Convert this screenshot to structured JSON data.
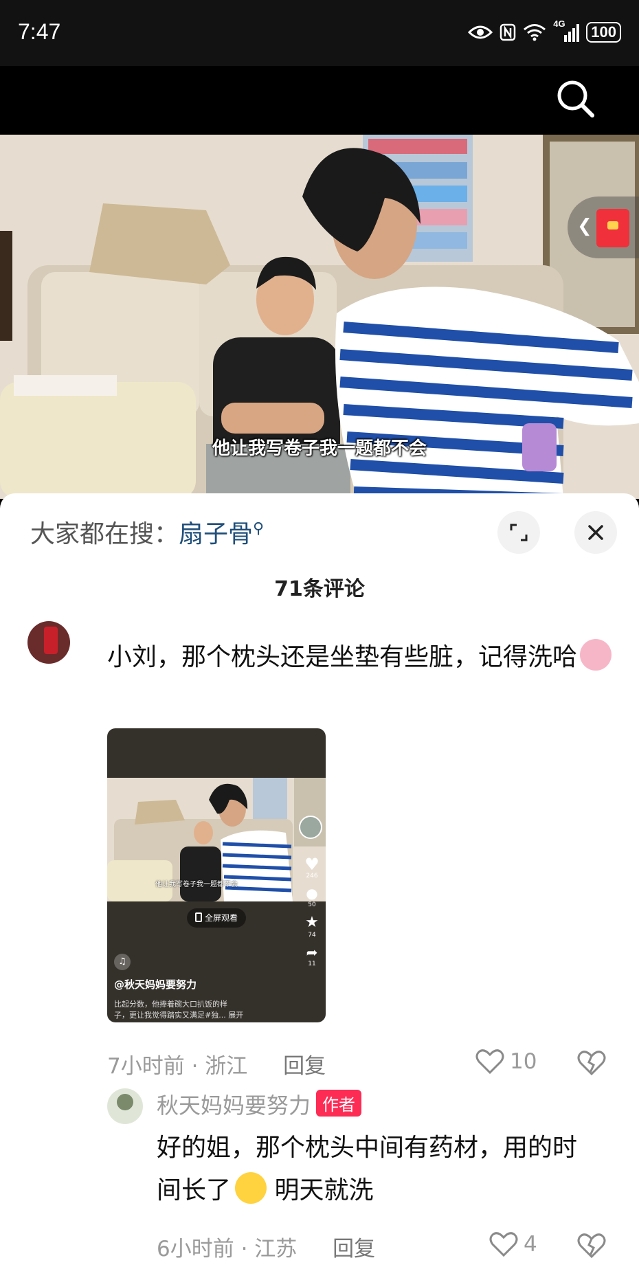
{
  "status": {
    "time": "7:47",
    "network": "4G",
    "battery": "100",
    "icons": [
      "eye-icon",
      "nfc-icon",
      "wifi-icon",
      "signal-icon",
      "battery-icon"
    ]
  },
  "header": {
    "icon": "search-icon"
  },
  "video": {
    "caption": "他让我写卷子我一题都不会",
    "side_icons": [
      "chevron-left-icon",
      "red-packet-icon"
    ]
  },
  "panel": {
    "search_prefix": "大家都在搜：",
    "search_term": "扇子骨",
    "expand_icon": "expand-icon",
    "close_icon": "close-icon",
    "comment_count": "71条评论"
  },
  "comments": [
    {
      "text": "小刘，那个枕头还是坐垫有些脏，记得洗哈",
      "emoji": "hug-emoji",
      "thumbnail": {
        "caption": "他让我写卷子我一题都不会",
        "fullscreen_label": "全屏观看",
        "counts": [
          "246",
          "50",
          "74",
          "11"
        ],
        "handle": "@秋天妈妈要努力",
        "desc_line1": "比起分数，他捧着碗大口扒饭的样",
        "desc_line2": "子，更让我觉得踏实又满足#独...",
        "expand": "展开"
      },
      "time": "7小时前",
      "location": "浙江",
      "reply": "回复",
      "likes": "10"
    },
    {
      "author": "秋天妈妈要努力",
      "badge": "作者",
      "text_line1": "好的姐，那个枕头中间有药材，用的时",
      "text_line2_a": "间长了",
      "emoji": "grinning-sweat-emoji",
      "text_line2_b": " 明天就洗",
      "time": "6小时前",
      "location": "江苏",
      "reply": "回复",
      "likes": "4"
    }
  ],
  "colors": {
    "badge": "#fd2c55",
    "search_term": "#1f4e79",
    "panel_bg": "#ffffff",
    "status_bg": "#121212"
  }
}
